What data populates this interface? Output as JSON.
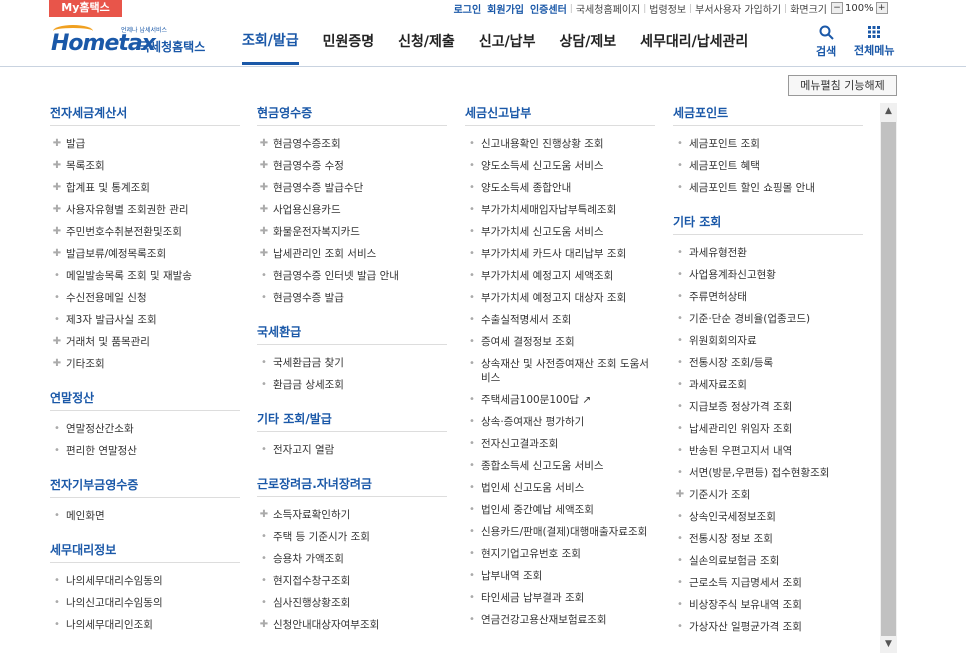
{
  "topbar": {
    "my_hometax": "My홈택스",
    "links": [
      "로그인",
      "회원가입",
      "인증센터",
      "국세청홈페이지",
      "법령정보",
      "부서사용자 가입하기",
      "화면크기"
    ],
    "zoom_minus": "−",
    "zoom_value": "100%",
    "zoom_plus": "+"
  },
  "header": {
    "logo_word": "Hometax",
    "logo_small": "언제나 납세서비스",
    "logo_kr": "국세청홈택스",
    "nav": [
      "조회/발급",
      "민원증명",
      "신청/제출",
      "신고/납부",
      "상담/제보",
      "세무대리/납세관리"
    ],
    "search": "검색",
    "all_menu": "전체메뉴"
  },
  "fold_button": "메뉴펼침 기능해제",
  "columns": [
    {
      "sections": [
        {
          "title": "전자세금계산서",
          "items": [
            {
              "label": "발급",
              "exp": true
            },
            {
              "label": "목록조회",
              "exp": true
            },
            {
              "label": "합계표 및 통계조회",
              "exp": true
            },
            {
              "label": "사용자유형별 조회권한 관리",
              "exp": true
            },
            {
              "label": "주민번호수취분전환및조회",
              "exp": true
            },
            {
              "label": "발급보류/예정목록조회",
              "exp": true
            },
            {
              "label": "메일발송목록 조회 및 재발송",
              "exp": false
            },
            {
              "label": "수신전용메일 신청",
              "exp": false
            },
            {
              "label": "제3자 발급사실 조회",
              "exp": false
            },
            {
              "label": "거래처 및 품목관리",
              "exp": true
            },
            {
              "label": "기타조회",
              "exp": true
            }
          ]
        },
        {
          "title": "연말정산",
          "items": [
            {
              "label": "연말정산간소화",
              "exp": false
            },
            {
              "label": "편리한 연말정산",
              "exp": false
            }
          ]
        },
        {
          "title": "전자기부금영수증",
          "items": [
            {
              "label": "메인화면",
              "exp": false
            }
          ]
        },
        {
          "title": "세무대리정보",
          "items": [
            {
              "label": "나의세무대리수임동의",
              "exp": false
            },
            {
              "label": "나의신고대리수임동의",
              "exp": false
            },
            {
              "label": "나의세무대리인조회",
              "exp": false
            }
          ]
        }
      ]
    },
    {
      "sections": [
        {
          "title": "현금영수증",
          "items": [
            {
              "label": "현금영수증조회",
              "exp": true
            },
            {
              "label": "현금영수증 수정",
              "exp": true
            },
            {
              "label": "현금영수증 발급수단",
              "exp": true
            },
            {
              "label": "사업용신용카드",
              "exp": true
            },
            {
              "label": "화물운전자복지카드",
              "exp": true
            },
            {
              "label": "납세관리인 조회 서비스",
              "exp": true
            },
            {
              "label": "현금영수증 인터넷 발급 안내",
              "exp": false
            },
            {
              "label": "현금영수증 발급",
              "exp": false
            }
          ]
        },
        {
          "title": "국세환급",
          "items": [
            {
              "label": "국세환급금 찾기",
              "exp": false
            },
            {
              "label": "환급금 상세조회",
              "exp": false
            }
          ]
        },
        {
          "title": "기타 조회/발급",
          "items": [
            {
              "label": "전자고지 열람",
              "exp": false
            }
          ]
        },
        {
          "title": "근로장려금.자녀장려금",
          "items": [
            {
              "label": "소득자료확인하기",
              "exp": true
            },
            {
              "label": "주택 등 기준시가 조회",
              "exp": false
            },
            {
              "label": "승용차 가액조회",
              "exp": false
            },
            {
              "label": "현지접수창구조회",
              "exp": false
            },
            {
              "label": "심사진행상황조회",
              "exp": false
            },
            {
              "label": "신청안내대상자여부조회",
              "exp": true
            }
          ]
        }
      ]
    },
    {
      "sections": [
        {
          "title": "세금신고납부",
          "items": [
            {
              "label": "신고내용확인 진행상황 조회",
              "exp": false
            },
            {
              "label": "양도소득세 신고도움 서비스",
              "exp": false
            },
            {
              "label": "양도소득세 종합안내",
              "exp": false
            },
            {
              "label": "부가가치세매입자납부특례조회",
              "exp": false
            },
            {
              "label": "부가가치세 신고도움 서비스",
              "exp": false
            },
            {
              "label": "부가가치세 카드사 대리납부 조회",
              "exp": false
            },
            {
              "label": "부가가치세 예정고지 세액조회",
              "exp": false
            },
            {
              "label": "부가가치세 예정고지 대상자 조회",
              "exp": false
            },
            {
              "label": "수출실적명세서 조회",
              "exp": false
            },
            {
              "label": "증여세 결정정보 조회",
              "exp": false
            },
            {
              "label": "상속재산 및 사전증여재산 조회 도움서비스",
              "exp": false
            },
            {
              "label": "주택세금100문100답 ↗",
              "exp": false
            },
            {
              "label": "상속·증여재산 평가하기",
              "exp": false
            },
            {
              "label": "전자신고결과조회",
              "exp": false
            },
            {
              "label": "종합소득세 신고도움 서비스",
              "exp": false
            },
            {
              "label": "법인세 신고도움 서비스",
              "exp": false
            },
            {
              "label": "법인세 중간예납 세액조회",
              "exp": false
            },
            {
              "label": "신용카드/판매(결제)대행매출자료조회",
              "exp": false
            },
            {
              "label": "현지기업고유번호 조회",
              "exp": false
            },
            {
              "label": "납부내역 조회",
              "exp": false
            },
            {
              "label": "타인세금 납부결과 조회",
              "exp": false
            },
            {
              "label": "연금건강고용산재보험료조회",
              "exp": false
            }
          ]
        }
      ]
    },
    {
      "sections": [
        {
          "title": "세금포인트",
          "items": [
            {
              "label": "세금포인트 조회",
              "exp": false
            },
            {
              "label": "세금포인트 혜택",
              "exp": false
            },
            {
              "label": "세금포인트 할인 쇼핑몰 안내",
              "exp": false
            }
          ]
        },
        {
          "title": "기타 조회",
          "items": [
            {
              "label": "과세유형전환",
              "exp": false
            },
            {
              "label": "사업용계좌신고현황",
              "exp": false
            },
            {
              "label": "주류면허상태",
              "exp": false
            },
            {
              "label": "기준·단순 경비율(업종코드)",
              "exp": false
            },
            {
              "label": "위원회회의자료",
              "exp": false
            },
            {
              "label": "전통시장 조회/등록",
              "exp": false
            },
            {
              "label": "과세자료조회",
              "exp": false
            },
            {
              "label": "지급보증 정상가격 조회",
              "exp": false
            },
            {
              "label": "납세관리인 위임자 조회",
              "exp": false
            },
            {
              "label": "반송된 우편고지서 내역",
              "exp": false
            },
            {
              "label": "서면(방문,우편등) 접수현황조회",
              "exp": false
            },
            {
              "label": "기준시가 조회",
              "exp": true
            },
            {
              "label": "상속인국세정보조회",
              "exp": false
            },
            {
              "label": "전통시장 정보 조회",
              "exp": false
            },
            {
              "label": "실손의료보험금 조회",
              "exp": false
            },
            {
              "label": "근로소득 지급명세서 조회",
              "exp": false
            },
            {
              "label": "비상장주식 보유내역 조회",
              "exp": false
            },
            {
              "label": "가상자산 일평균가격 조회",
              "exp": false
            }
          ]
        }
      ]
    }
  ]
}
